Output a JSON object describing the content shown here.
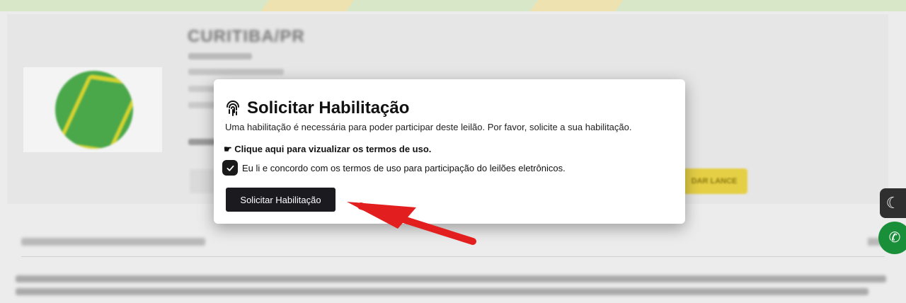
{
  "auction": {
    "city": "CURITIBA/PR",
    "lance_label": "DAR LANCE"
  },
  "modal": {
    "title": "Solicitar Habilitação",
    "description": "Uma habilitação é necessária para poder participar deste leilão. Por favor, solicite a sua habilitação.",
    "terms_link_icon": "☛",
    "terms_link": "Clique aqui para vizualizar os termos de uso.",
    "terms_checkbox_label": "Eu li e concordo com os termos de uso para participação do leilões eletrônicos.",
    "terms_checked": true,
    "submit_label": "Solicitar Habilitação"
  },
  "widgets": {
    "theme_toggle_icon": "☾",
    "whatsapp_icon": "✆"
  },
  "colors": {
    "button_bg": "#1b1b1f",
    "arrow": "#e31e1e",
    "whatsapp_green": "#1a8f3a",
    "lance_yellow": "#e5cf45"
  }
}
